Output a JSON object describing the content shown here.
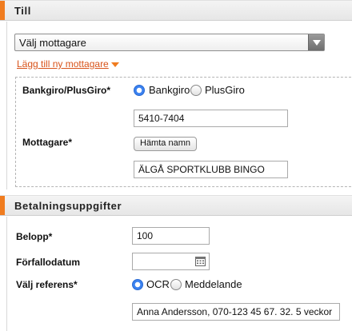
{
  "till": {
    "header": "Till",
    "recipient_select": {
      "value": "Välj mottagare"
    },
    "add_recipient_link": "Lägg till ny mottagare",
    "bankgiro_label": "Bankgiro/PlusGiro*",
    "radio_bankgiro": "Bankgiro",
    "radio_plusgiro": "PlusGiro",
    "account_number": "5410-7404",
    "recipient_label": "Mottagare*",
    "fetch_name_button": "Hämta namn",
    "recipient_name": "ÄLGÅ SPORTKLUBB BINGO"
  },
  "payment": {
    "header": "Betalningsuppgifter",
    "amount_label": "Belopp*",
    "amount_value": "100",
    "due_date_label": "Förfallodatum",
    "due_date_value": "",
    "reference_label": "Välj referens*",
    "radio_ocr": "OCR",
    "radio_message": "Meddelande",
    "reference_value": "Anna Andersson, 070-123 45 67. 32. 5 veckor"
  },
  "colors": {
    "accent": "#f07c1f",
    "link": "#d8531a",
    "radio_selected": "#3b82f0"
  },
  "icons": [
    "chevron-down-icon",
    "caret-down-icon",
    "calendar-icon"
  ]
}
